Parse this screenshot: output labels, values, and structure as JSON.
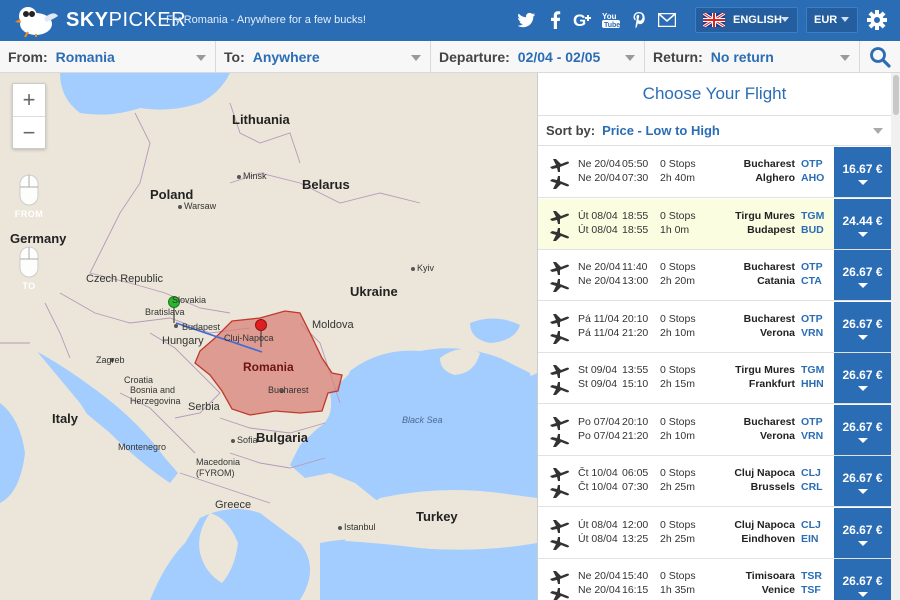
{
  "header": {
    "brand_bold": "SKY",
    "brand_light": "PICKER",
    "tagline": "Fly Romania - Anywhere for a few bucks!",
    "social_icons": [
      "twitter-icon",
      "facebook-icon",
      "google-plus-icon",
      "youtube-icon",
      "pinterest-icon",
      "email-icon"
    ],
    "language": "ENGLISH",
    "currency": "EUR"
  },
  "search": {
    "from_label": "From:",
    "from_value": "Romania",
    "to_label": "To:",
    "to_value": "Anywhere",
    "departure_label": "Departure:",
    "departure_value": "02/04 - 02/05",
    "return_label": "Return:",
    "return_value": "No return"
  },
  "map": {
    "zoom_in": "+",
    "zoom_out": "−",
    "from_tool": "FROM",
    "to_tool": "TO",
    "labels": {
      "lithuania": "Lithuania",
      "belarus": "Belarus",
      "poland": "Poland",
      "germany": "Germany",
      "czech": "Czech Republic",
      "slovakia": "Slovakia",
      "ukraine": "Ukraine",
      "moldova": "Moldova",
      "hungary": "Hungary",
      "romania": "Romania",
      "italy": "Italy",
      "croatia": "Croatia",
      "bosnia": "Bosnia and Herzegovina",
      "serbia": "Serbia",
      "bulgaria": "Bulgaria",
      "montenegro": "Montenegro",
      "macedonia": "Macedonia (FYROM)",
      "greece": "Greece",
      "turkey": "Turkey",
      "black_sea": "Black Sea",
      "bratislava": "Bratislava",
      "budapest": "Budapest",
      "cluj": "Cluj-Napoca",
      "bucharest": "Bucharest",
      "zagreb": "Zagreb",
      "minsk": "Minsk",
      "warsaw": "Warsaw",
      "kyiv": "Kyiv",
      "sofia": "Sofia",
      "istanbul": "Istanbul"
    }
  },
  "results": {
    "title": "Choose Your Flight",
    "sort_label": "Sort by:",
    "sort_value": "Price - Low to High",
    "flights": [
      {
        "d1": "Ne 20/04",
        "t1": "05:50",
        "stops": "0 Stops",
        "d2": "Ne 20/04",
        "t2": "07:30",
        "dur": "2h 40m",
        "from": "Bucharest",
        "from_code": "OTP",
        "to": "Alghero",
        "to_code": "AHO",
        "price": "16.67 €"
      },
      {
        "d1": "Út 08/04",
        "t1": "18:55",
        "stops": "0 Stops",
        "d2": "Út 08/04",
        "t2": "18:55",
        "dur": "1h 0m",
        "from": "Tirgu Mures",
        "from_code": "TGM",
        "to": "Budapest",
        "to_code": "BUD",
        "price": "24.44 €"
      },
      {
        "d1": "Ne 20/04",
        "t1": "11:40",
        "stops": "0 Stops",
        "d2": "Ne 20/04",
        "t2": "13:00",
        "dur": "2h 20m",
        "from": "Bucharest",
        "from_code": "OTP",
        "to": "Catania",
        "to_code": "CTA",
        "price": "26.67 €"
      },
      {
        "d1": "Pá 11/04",
        "t1": "20:10",
        "stops": "0 Stops",
        "d2": "Pá 11/04",
        "t2": "21:20",
        "dur": "2h 10m",
        "from": "Bucharest",
        "from_code": "OTP",
        "to": "Verona",
        "to_code": "VRN",
        "price": "26.67 €"
      },
      {
        "d1": "St 09/04",
        "t1": "13:55",
        "stops": "0 Stops",
        "d2": "St 09/04",
        "t2": "15:10",
        "dur": "2h 15m",
        "from": "Tirgu Mures",
        "from_code": "TGM",
        "to": "Frankfurt",
        "to_code": "HHN",
        "price": "26.67 €"
      },
      {
        "d1": "Po 07/04",
        "t1": "20:10",
        "stops": "0 Stops",
        "d2": "Po 07/04",
        "t2": "21:20",
        "dur": "2h 10m",
        "from": "Bucharest",
        "from_code": "OTP",
        "to": "Verona",
        "to_code": "VRN",
        "price": "26.67 €"
      },
      {
        "d1": "Čt 10/04",
        "t1": "06:05",
        "stops": "0 Stops",
        "d2": "Čt 10/04",
        "t2": "07:30",
        "dur": "2h 25m",
        "from": "Cluj Napoca",
        "from_code": "CLJ",
        "to": "Brussels",
        "to_code": "CRL",
        "price": "26.67 €"
      },
      {
        "d1": "Út 08/04",
        "t1": "12:00",
        "stops": "0 Stops",
        "d2": "Út 08/04",
        "t2": "13:25",
        "dur": "2h 25m",
        "from": "Cluj Napoca",
        "from_code": "CLJ",
        "to": "Eindhoven",
        "to_code": "EIN",
        "price": "26.67 €"
      },
      {
        "d1": "Ne 20/04",
        "t1": "15:40",
        "stops": "0 Stops",
        "d2": "Ne 20/04",
        "t2": "16:15",
        "dur": "1h 35m",
        "from": "Timisoara",
        "from_code": "TSR",
        "to": "Venice",
        "to_code": "TSF",
        "price": "26.67 €"
      }
    ]
  },
  "colors": {
    "brand_blue": "#2b6db5",
    "highlight_row": "#fbfde0",
    "romania_fill": "#d9817a"
  }
}
